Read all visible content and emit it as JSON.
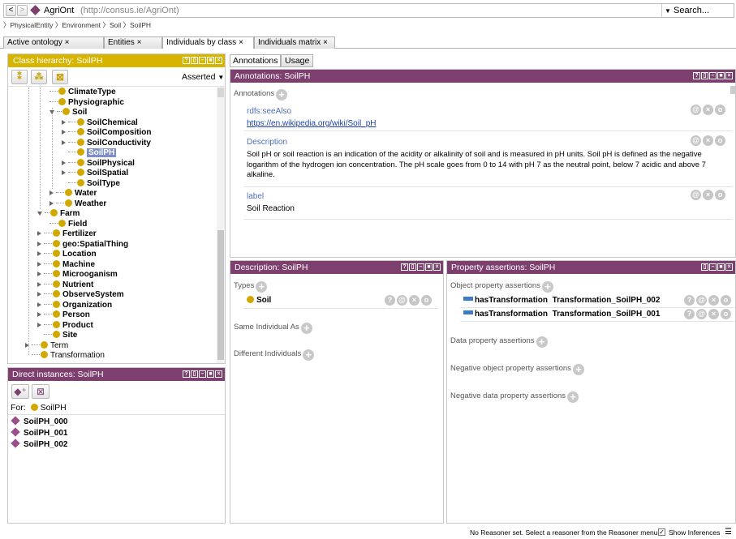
{
  "address_bar": {
    "back": "<",
    "forward": ">",
    "name": "AgriOnt",
    "url": "(http://consus.ie/AgriOnt)",
    "search_label": "Search..."
  },
  "breadcrumb": [
    "PhysicalEntity",
    "Environment",
    "Soil",
    "SoilPH"
  ],
  "tabs": [
    {
      "label": "Active ontology",
      "close": "×"
    },
    {
      "label": "Entities",
      "close": "×"
    },
    {
      "label": "Individuals by class",
      "close": "×"
    },
    {
      "label": "Individuals matrix",
      "close": "×"
    }
  ],
  "class_hierarchy": {
    "title": "Class hierarchy: SoilPH",
    "mode": "Asserted",
    "items": [
      {
        "label": "ClimateType"
      },
      {
        "label": "Physiographic"
      },
      {
        "label": "Soil"
      },
      {
        "label": "SoilChemical"
      },
      {
        "label": "SoilComposition"
      },
      {
        "label": "SoilConductivity"
      },
      {
        "label": "SoilPH"
      },
      {
        "label": "SoilPhysical"
      },
      {
        "label": "SoilSpatial"
      },
      {
        "label": "SoilType"
      },
      {
        "label": "Water"
      },
      {
        "label": "Weather"
      },
      {
        "label": "Farm"
      },
      {
        "label": "Field"
      },
      {
        "label": "Fertilizer"
      },
      {
        "label": "geo:SpatialThing"
      },
      {
        "label": "Location"
      },
      {
        "label": "Machine"
      },
      {
        "label": "Microoganism"
      },
      {
        "label": "Nutrient"
      },
      {
        "label": "ObserveSystem"
      },
      {
        "label": "Organization"
      },
      {
        "label": "Person"
      },
      {
        "label": "Product"
      },
      {
        "label": "Site"
      },
      {
        "label": "Term"
      },
      {
        "label": "Transformation"
      }
    ]
  },
  "direct_instances": {
    "title": "Direct instances: SoilPH",
    "for_label": "For:",
    "for_value": "SoilPH",
    "items": [
      "SoilPH_000",
      "SoilPH_001",
      "SoilPH_002"
    ]
  },
  "right_tabs": [
    "Annotations",
    "Usage"
  ],
  "annotations": {
    "title": "Annotations: SoilPH",
    "section_label": "Annotations",
    "entries": [
      {
        "property": "rdfs:seeAlso",
        "value": "https://en.wikipedia.org/wiki/Soil_pH"
      },
      {
        "property": "Description",
        "value": "Soil pH or soil reaction is an indication of the acidity or alkalinity of soil and is measured in pH units. Soil pH is defined as the negative logarithm of the hydrogen ion concentration. The pH scale goes from 0 to 14 with pH 7 as the neutral point, below 7 acidic and above 7 alkaline."
      },
      {
        "property": "label",
        "value": "Soil Reaction"
      }
    ]
  },
  "description": {
    "title": "Description: SoilPH",
    "types_label": "Types",
    "types": [
      "Soil"
    ],
    "same_individual": "Same Individual As",
    "different_individuals": "Different Individuals"
  },
  "property_assertions": {
    "title": "Property assertions: SoilPH",
    "object_label": "Object property assertions",
    "object_items": [
      {
        "property": "hasTransformation",
        "value": "Transformation_SoilPH_002"
      },
      {
        "property": "hasTransformation",
        "value": "Transformation_SoilPH_001"
      }
    ],
    "data_label": "Data property assertions",
    "neg_object_label": "Negative object property assertions",
    "neg_data_label": "Negative data property assertions"
  },
  "status": {
    "message": "No Reasoner set. Select a reasoner from the Reasoner menu",
    "show_inferences": "Show Inferences"
  },
  "colors": {
    "class_gold": "#d6b400",
    "individual_purple": "#7d3f6e",
    "link_blue": "#4d6fb8"
  }
}
